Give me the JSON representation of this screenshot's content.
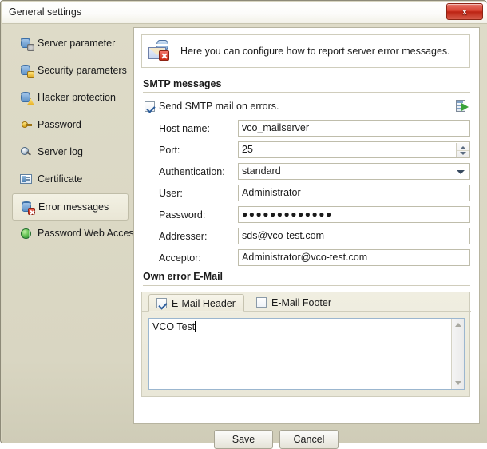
{
  "window": {
    "title": "General settings",
    "close_label": "x"
  },
  "sidebar": {
    "items": [
      {
        "label": "Server parameter",
        "icon": "database-gear-icon",
        "selected": false
      },
      {
        "label": "Security parameters",
        "icon": "database-lock-icon",
        "selected": false
      },
      {
        "label": "Hacker protection",
        "icon": "database-warning-icon",
        "selected": false
      },
      {
        "label": "Password",
        "icon": "key-icon",
        "selected": false
      },
      {
        "label": "Server log",
        "icon": "magnifier-icon",
        "selected": false
      },
      {
        "label": "Certificate",
        "icon": "certificate-icon",
        "selected": false
      },
      {
        "label": "Error messages",
        "icon": "database-error-icon",
        "selected": true
      },
      {
        "label": "Password Web Access",
        "icon": "globe-icon",
        "selected": false
      }
    ]
  },
  "main": {
    "banner": {
      "icon": "mail-error-icon",
      "text": "Here you can configure how to report server error messages."
    },
    "smtp_group": {
      "heading": "SMTP messages",
      "enable_checkbox": {
        "label": "Send SMTP mail on errors.",
        "checked": true
      },
      "test_icon": "send-test-mail-icon",
      "fields": [
        {
          "label": "Host name:",
          "value": "vco_mailserver",
          "type": "text"
        },
        {
          "label": "Port:",
          "value": "25",
          "type": "spinner"
        },
        {
          "label": "Authentication:",
          "value": "standard",
          "type": "select"
        },
        {
          "label": "User:",
          "value": "Administrator",
          "type": "text"
        },
        {
          "label": "Password:",
          "value": "●●●●●●●●●●●●●",
          "type": "password"
        },
        {
          "label": "Addresser:",
          "value": "sds@vco-test.com",
          "type": "text"
        },
        {
          "label": "Acceptor:",
          "value": "Administrator@vco-test.com",
          "type": "text"
        }
      ]
    },
    "own_mail_group": {
      "heading": "Own error E-Mail",
      "tabs": [
        {
          "label": "E-Mail Header",
          "checked": true,
          "active": true
        },
        {
          "label": "E-Mail Footer",
          "checked": false,
          "active": false
        }
      ],
      "editor": {
        "value": "VCO Test"
      }
    }
  },
  "footer": {
    "save_label": "Save",
    "cancel_label": "Cancel"
  },
  "colors": {
    "window_bg": "#d9d6c2",
    "panel_bg": "#ffffff",
    "close_red": "#bd2313",
    "accent_check": "#2c5d9b"
  }
}
